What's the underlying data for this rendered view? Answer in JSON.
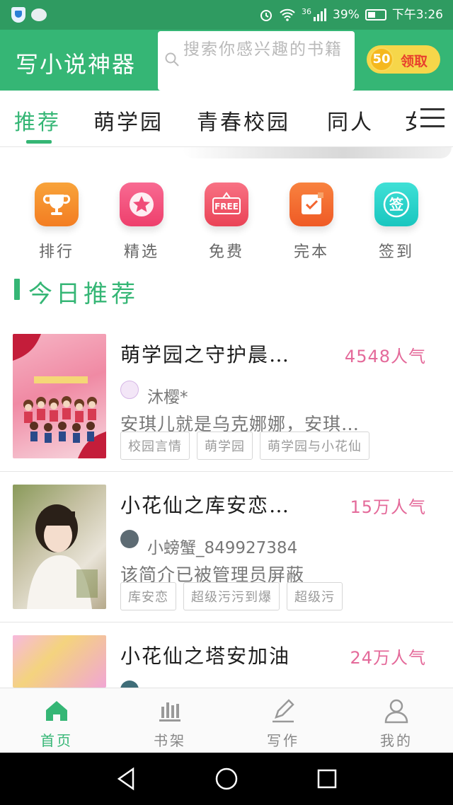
{
  "status_bar": {
    "network": "36",
    "battery": "39%",
    "time": "下午3:26"
  },
  "header": {
    "app_title": "写小说神器",
    "search_placeholder": "搜索你感兴趣的书籍",
    "coin_value": "50",
    "reward_label": "领取"
  },
  "tabs": [
    {
      "label": "推荐",
      "active": true
    },
    {
      "label": "萌学园"
    },
    {
      "label": "青春校园"
    },
    {
      "label": "同人"
    },
    {
      "label": "女"
    }
  ],
  "quick_links": [
    {
      "label": "排行",
      "icon": "trophy-icon",
      "color": "#f58a2a"
    },
    {
      "label": "精选",
      "icon": "star-icon",
      "color": "#f2507a"
    },
    {
      "label": "免费",
      "icon": "free-icon",
      "color": "#f05466"
    },
    {
      "label": "完本",
      "icon": "check-icon",
      "color": "#f2642e"
    },
    {
      "label": "签到",
      "icon": "sign-in-icon",
      "color": "#26d0c9",
      "glyph": "签"
    }
  ],
  "section": {
    "title": "今日推荐"
  },
  "books": [
    {
      "title": "萌学园之守护晨…",
      "popularity": "4548人气",
      "author": "沐樱*",
      "description": "安琪儿就是乌克娜娜，安琪…",
      "tags": [
        "校园言情",
        "萌学园",
        "萌学园与小花仙"
      ]
    },
    {
      "title": "小花仙之库安恋…",
      "popularity": "15万人气",
      "author": "小螃蟹_849927384",
      "description": "该简介已被管理员屏蔽",
      "tags": [
        "库安恋",
        "超级污污到爆",
        "超级污"
      ]
    },
    {
      "title": "小花仙之塔安加油",
      "popularity": "24万人气"
    }
  ],
  "bottom_nav": [
    {
      "label": "首页",
      "icon": "home-icon",
      "active": true
    },
    {
      "label": "书架",
      "icon": "bookshelf-icon"
    },
    {
      "label": "写作",
      "icon": "pen-icon"
    },
    {
      "label": "我的",
      "icon": "profile-icon"
    }
  ],
  "colors": {
    "brand": "#35b675",
    "status_bar": "#2f9b61",
    "popularity": "#e46a9a",
    "reward_bg": "#f6d64a"
  }
}
